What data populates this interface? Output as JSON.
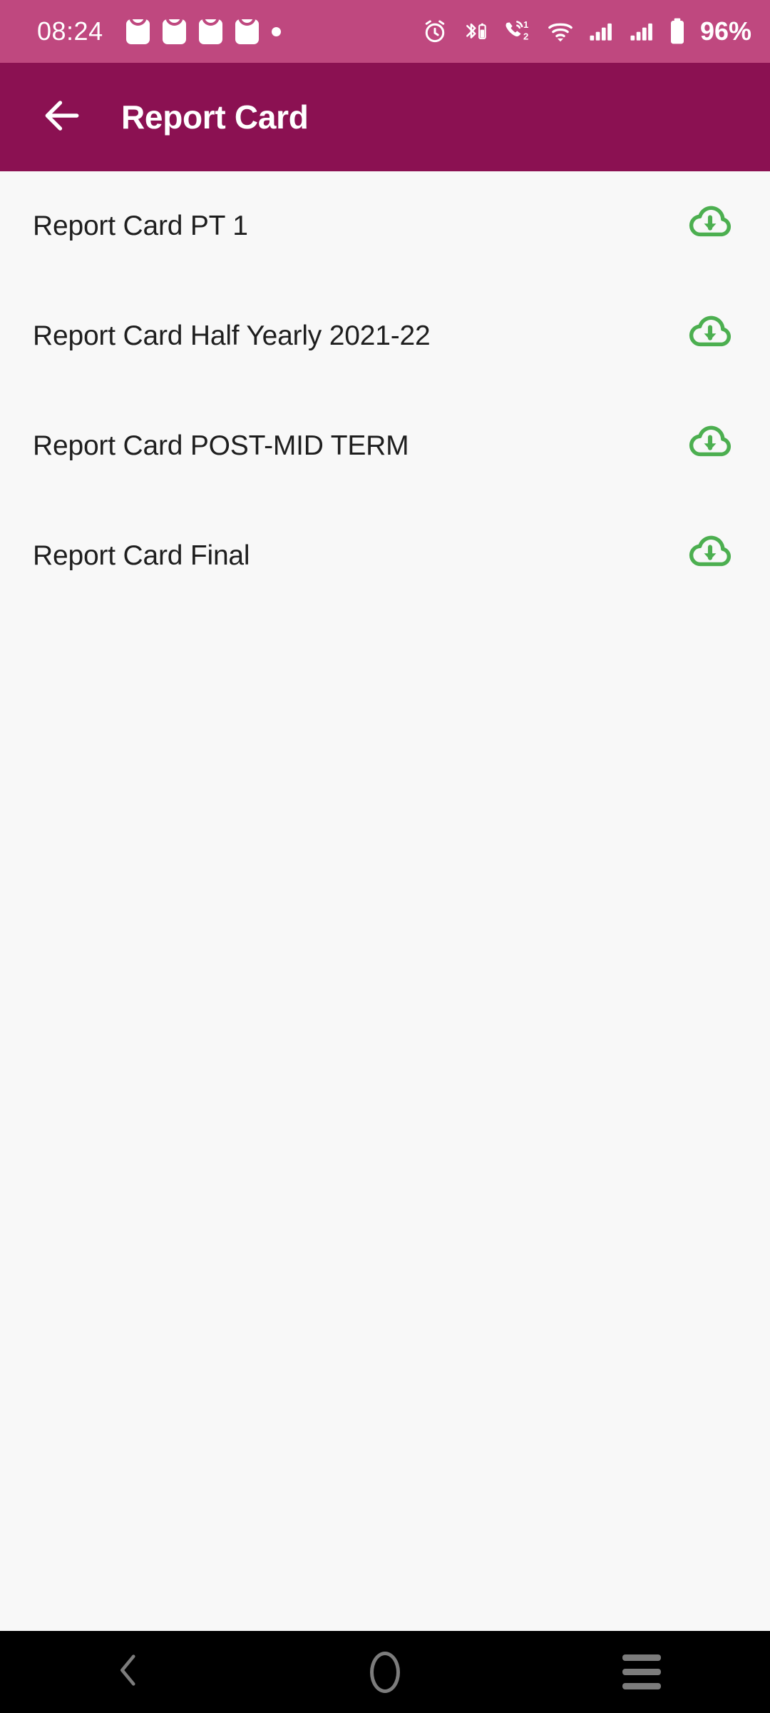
{
  "status_bar": {
    "time": "08:24",
    "background_color": "#BF487F",
    "left_icons": [
      {
        "name": "mail-icon",
        "label": "mail"
      },
      {
        "name": "mail-icon",
        "label": "mail"
      },
      {
        "name": "mail-icon",
        "label": "mail"
      },
      {
        "name": "mail-icon",
        "label": "mail"
      },
      {
        "name": "notification-dot-icon",
        "label": "dot"
      }
    ],
    "right_icons": [
      {
        "name": "alarm-clock-icon",
        "label": "alarm"
      },
      {
        "name": "bluetooth-battery-icon",
        "label": "bluetooth device battery"
      },
      {
        "name": "missed-call-icon",
        "label": "missed calls",
        "badge_top": "1",
        "badge_bottom": "2"
      },
      {
        "name": "wifi-icon",
        "label": "wifi"
      },
      {
        "name": "signal-sim1-icon",
        "label": "signal sim 1"
      },
      {
        "name": "signal-sim2-icon",
        "label": "signal sim 2"
      },
      {
        "name": "battery-icon",
        "label": "battery"
      }
    ],
    "battery_percent": "96%"
  },
  "app_bar": {
    "back_icon": "arrow-left-icon",
    "title": "Report Card",
    "background_color": "#8B1152",
    "text_color": "#FFFFFF"
  },
  "list": {
    "download_icon": "cloud-download-icon",
    "download_icon_color": "#4CAF50",
    "items": [
      {
        "label": "Report Card PT 1"
      },
      {
        "label": "Report Card Half Yearly 2021-22"
      },
      {
        "label": "Report Card POST-MID TERM"
      },
      {
        "label": "Report Card Final"
      }
    ]
  },
  "nav_bar": {
    "background_color": "#000000",
    "icon_color": "#7C7C7C",
    "buttons": [
      {
        "name": "nav-back-button",
        "icon": "chevron-left-icon"
      },
      {
        "name": "nav-home-button",
        "icon": "circle-icon"
      },
      {
        "name": "nav-recents-button",
        "icon": "hamburger-icon"
      }
    ]
  }
}
